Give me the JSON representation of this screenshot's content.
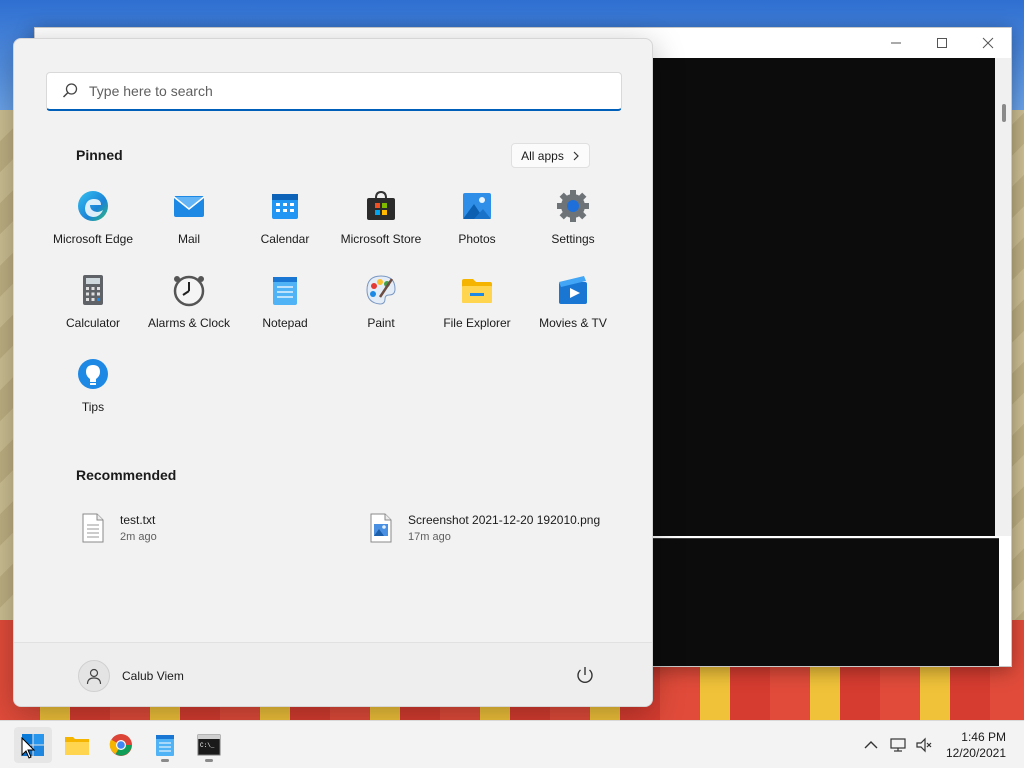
{
  "search": {
    "placeholder": "Type here to search"
  },
  "pinned": {
    "title": "Pinned",
    "all_apps_label": "All apps",
    "apps": [
      {
        "label": "Microsoft Edge",
        "icon": "edge-icon"
      },
      {
        "label": "Mail",
        "icon": "mail-icon"
      },
      {
        "label": "Calendar",
        "icon": "calendar-icon"
      },
      {
        "label": "Microsoft Store",
        "icon": "store-icon"
      },
      {
        "label": "Photos",
        "icon": "photos-icon"
      },
      {
        "label": "Settings",
        "icon": "settings-icon"
      },
      {
        "label": "Calculator",
        "icon": "calculator-icon"
      },
      {
        "label": "Alarms & Clock",
        "icon": "clock-icon"
      },
      {
        "label": "Notepad",
        "icon": "notepad-icon"
      },
      {
        "label": "Paint",
        "icon": "paint-icon"
      },
      {
        "label": "File Explorer",
        "icon": "folder-icon"
      },
      {
        "label": "Movies & TV",
        "icon": "movies-icon"
      },
      {
        "label": "Tips",
        "icon": "tips-icon"
      }
    ]
  },
  "recommended": {
    "title": "Recommended",
    "items": [
      {
        "name": "test.txt",
        "time": "2m ago",
        "icon": "text-file-icon"
      },
      {
        "name": "Screenshot 2021-12-20 192010.png",
        "time": "17m ago",
        "icon": "image-file-icon"
      }
    ]
  },
  "user": {
    "name": "Calub Viem"
  },
  "taskbar": {
    "apps": [
      "start-icon",
      "folder-icon",
      "chrome-icon",
      "notepad-icon",
      "terminal-icon"
    ],
    "clock": {
      "time": "1:46 PM",
      "date": "12/20/2021"
    }
  },
  "colors": {
    "accent": "#005fb8",
    "menu_bg": "#f2f2f2",
    "console_bg": "#0c0c0c"
  }
}
